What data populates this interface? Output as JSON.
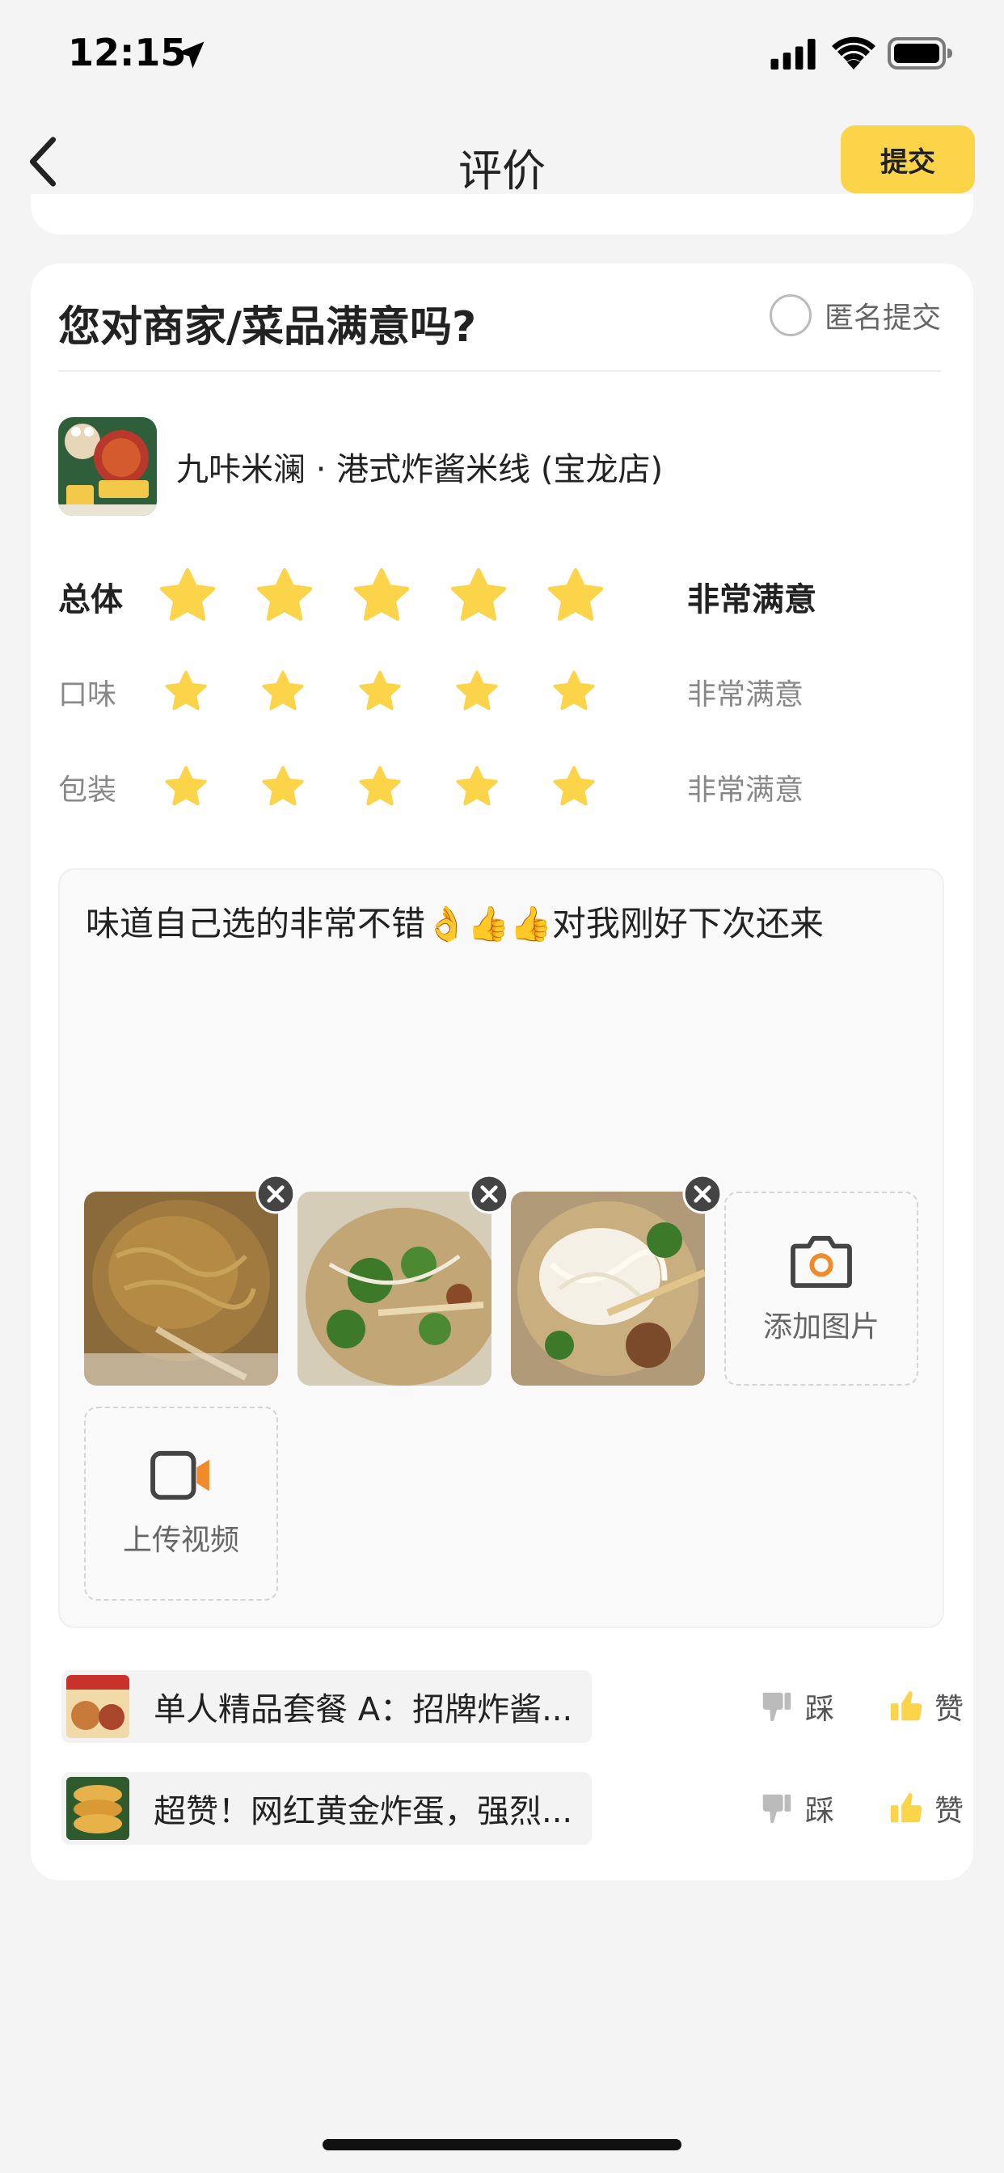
{
  "status_bar": {
    "time": "12:15"
  },
  "nav": {
    "title": "评价",
    "submit_label": "提交"
  },
  "card": {
    "title": "您对商家/菜品满意吗?",
    "anonymous_label": "匿名提交",
    "shop_name": "九咔米澜 · 港式炸酱米线 (宝龙店)",
    "shop_logo_icon": "shop-logo-icon",
    "ratings": [
      {
        "label": "总体",
        "stars": 5,
        "text": "非常满意"
      },
      {
        "label": "口味",
        "stars": 5,
        "text": "非常满意"
      },
      {
        "label": "包装",
        "stars": 5,
        "text": "非常满意"
      }
    ],
    "star_color": "#fbd44a"
  },
  "review": {
    "text": "味道自己选的非常不错👌👍👍对我刚好下次还来",
    "photos": [
      "noodles-sauce-photo",
      "noodle-soup-greens-photo",
      "rice-noodles-chopsticks-photo"
    ],
    "add_photo_label": "添加图片",
    "upload_video_label": "上传视频",
    "accent_color": "#f08a2a"
  },
  "dishes": [
    {
      "name": "单人精品套餐 A：招牌炸酱...",
      "dislike_label": "踩",
      "like_label": "赞"
    },
    {
      "name": "超赞！网红黄金炸蛋，强烈...",
      "dislike_label": "踩",
      "like_label": "赞"
    }
  ],
  "colors": {
    "accent": "#fbd44a",
    "background": "#f4f4f4"
  }
}
